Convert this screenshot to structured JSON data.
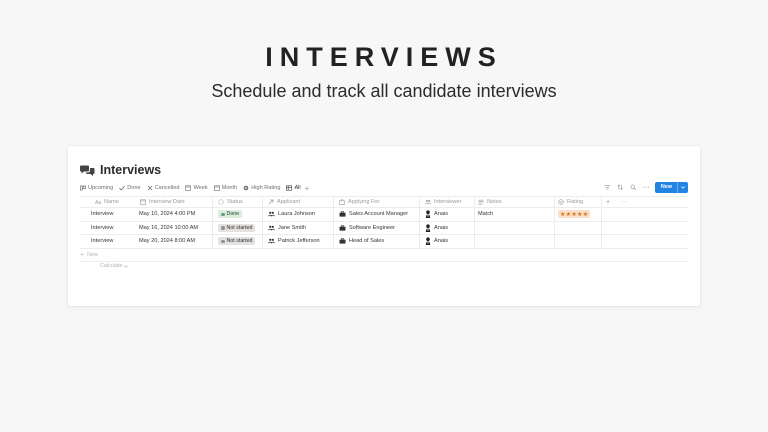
{
  "hero": {
    "title": "INTERVIEWS",
    "subtitle": "Schedule and track all candidate interviews"
  },
  "database": {
    "icon": "chat-bubbles-icon",
    "title": "Interviews"
  },
  "views": [
    {
      "label": "Upcoming",
      "icon": "board-icon",
      "active": false
    },
    {
      "label": "Done",
      "icon": "check-icon",
      "active": false
    },
    {
      "label": "Cancelled",
      "icon": "x-icon",
      "active": false
    },
    {
      "label": "Week",
      "icon": "calendar-icon",
      "active": false
    },
    {
      "label": "Month",
      "icon": "calendar-icon",
      "active": false
    },
    {
      "label": "High Rating",
      "icon": "gear-icon",
      "active": false
    },
    {
      "label": "All",
      "icon": "table-icon",
      "active": true
    }
  ],
  "toolbar": {
    "new_label": "New"
  },
  "columns": {
    "name": "Name",
    "date": "Interview Date",
    "status": "Status",
    "applicant": "Applicant",
    "applying_for": "Applying For",
    "interviewer": "Interviewer",
    "notes": "Notes",
    "rating": "Rating"
  },
  "rows": [
    {
      "name": "Interview",
      "date": "May 10, 2024 4:00 PM",
      "status": "Done",
      "applicant": "Laura Johnson",
      "applying_for": "Sales Account Manager",
      "interviewer": "Anais",
      "notes": "Match",
      "rating": "★★★★★"
    },
    {
      "name": "Interview",
      "date": "May 16, 2024 10:00 AM",
      "status": "Not started",
      "applicant": "Jane Smith",
      "applying_for": "Software Engineer",
      "interviewer": "Anais",
      "notes": "",
      "rating": ""
    },
    {
      "name": "Interview",
      "date": "May 20, 2024 8:00 AM",
      "status": "Not started",
      "applicant": "Patrick Jefferson",
      "applying_for": "Head of Sales",
      "interviewer": "Anais",
      "notes": "",
      "rating": ""
    }
  ],
  "footer": {
    "new_row_label": "New",
    "calculate_label": "Calculate"
  },
  "colors": {
    "accent": "#2383e2",
    "done_bg": "#dbeddb",
    "not_started_bg": "#e3e2e0",
    "rating_bg": "#fadec9",
    "rating_fg": "#d9730d"
  }
}
